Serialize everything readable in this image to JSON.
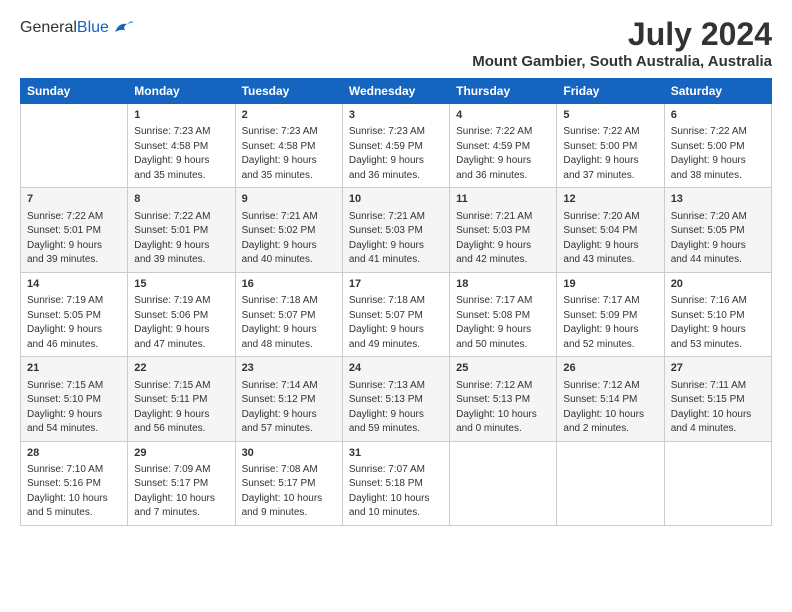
{
  "header": {
    "logo_general": "General",
    "logo_blue": "Blue",
    "title": "July 2024",
    "subtitle": "Mount Gambier, South Australia, Australia"
  },
  "days_of_week": [
    "Sunday",
    "Monday",
    "Tuesday",
    "Wednesday",
    "Thursday",
    "Friday",
    "Saturday"
  ],
  "weeks": [
    [
      {
        "day": "",
        "info": ""
      },
      {
        "day": "1",
        "info": "Sunrise: 7:23 AM\nSunset: 4:58 PM\nDaylight: 9 hours\nand 35 minutes."
      },
      {
        "day": "2",
        "info": "Sunrise: 7:23 AM\nSunset: 4:58 PM\nDaylight: 9 hours\nand 35 minutes."
      },
      {
        "day": "3",
        "info": "Sunrise: 7:23 AM\nSunset: 4:59 PM\nDaylight: 9 hours\nand 36 minutes."
      },
      {
        "day": "4",
        "info": "Sunrise: 7:22 AM\nSunset: 4:59 PM\nDaylight: 9 hours\nand 36 minutes."
      },
      {
        "day": "5",
        "info": "Sunrise: 7:22 AM\nSunset: 5:00 PM\nDaylight: 9 hours\nand 37 minutes."
      },
      {
        "day": "6",
        "info": "Sunrise: 7:22 AM\nSunset: 5:00 PM\nDaylight: 9 hours\nand 38 minutes."
      }
    ],
    [
      {
        "day": "7",
        "info": "Sunrise: 7:22 AM\nSunset: 5:01 PM\nDaylight: 9 hours\nand 39 minutes."
      },
      {
        "day": "8",
        "info": "Sunrise: 7:22 AM\nSunset: 5:01 PM\nDaylight: 9 hours\nand 39 minutes."
      },
      {
        "day": "9",
        "info": "Sunrise: 7:21 AM\nSunset: 5:02 PM\nDaylight: 9 hours\nand 40 minutes."
      },
      {
        "day": "10",
        "info": "Sunrise: 7:21 AM\nSunset: 5:03 PM\nDaylight: 9 hours\nand 41 minutes."
      },
      {
        "day": "11",
        "info": "Sunrise: 7:21 AM\nSunset: 5:03 PM\nDaylight: 9 hours\nand 42 minutes."
      },
      {
        "day": "12",
        "info": "Sunrise: 7:20 AM\nSunset: 5:04 PM\nDaylight: 9 hours\nand 43 minutes."
      },
      {
        "day": "13",
        "info": "Sunrise: 7:20 AM\nSunset: 5:05 PM\nDaylight: 9 hours\nand 44 minutes."
      }
    ],
    [
      {
        "day": "14",
        "info": "Sunrise: 7:19 AM\nSunset: 5:05 PM\nDaylight: 9 hours\nand 46 minutes."
      },
      {
        "day": "15",
        "info": "Sunrise: 7:19 AM\nSunset: 5:06 PM\nDaylight: 9 hours\nand 47 minutes."
      },
      {
        "day": "16",
        "info": "Sunrise: 7:18 AM\nSunset: 5:07 PM\nDaylight: 9 hours\nand 48 minutes."
      },
      {
        "day": "17",
        "info": "Sunrise: 7:18 AM\nSunset: 5:07 PM\nDaylight: 9 hours\nand 49 minutes."
      },
      {
        "day": "18",
        "info": "Sunrise: 7:17 AM\nSunset: 5:08 PM\nDaylight: 9 hours\nand 50 minutes."
      },
      {
        "day": "19",
        "info": "Sunrise: 7:17 AM\nSunset: 5:09 PM\nDaylight: 9 hours\nand 52 minutes."
      },
      {
        "day": "20",
        "info": "Sunrise: 7:16 AM\nSunset: 5:10 PM\nDaylight: 9 hours\nand 53 minutes."
      }
    ],
    [
      {
        "day": "21",
        "info": "Sunrise: 7:15 AM\nSunset: 5:10 PM\nDaylight: 9 hours\nand 54 minutes."
      },
      {
        "day": "22",
        "info": "Sunrise: 7:15 AM\nSunset: 5:11 PM\nDaylight: 9 hours\nand 56 minutes."
      },
      {
        "day": "23",
        "info": "Sunrise: 7:14 AM\nSunset: 5:12 PM\nDaylight: 9 hours\nand 57 minutes."
      },
      {
        "day": "24",
        "info": "Sunrise: 7:13 AM\nSunset: 5:13 PM\nDaylight: 9 hours\nand 59 minutes."
      },
      {
        "day": "25",
        "info": "Sunrise: 7:12 AM\nSunset: 5:13 PM\nDaylight: 10 hours\nand 0 minutes."
      },
      {
        "day": "26",
        "info": "Sunrise: 7:12 AM\nSunset: 5:14 PM\nDaylight: 10 hours\nand 2 minutes."
      },
      {
        "day": "27",
        "info": "Sunrise: 7:11 AM\nSunset: 5:15 PM\nDaylight: 10 hours\nand 4 minutes."
      }
    ],
    [
      {
        "day": "28",
        "info": "Sunrise: 7:10 AM\nSunset: 5:16 PM\nDaylight: 10 hours\nand 5 minutes."
      },
      {
        "day": "29",
        "info": "Sunrise: 7:09 AM\nSunset: 5:17 PM\nDaylight: 10 hours\nand 7 minutes."
      },
      {
        "day": "30",
        "info": "Sunrise: 7:08 AM\nSunset: 5:17 PM\nDaylight: 10 hours\nand 9 minutes."
      },
      {
        "day": "31",
        "info": "Sunrise: 7:07 AM\nSunset: 5:18 PM\nDaylight: 10 hours\nand 10 minutes."
      },
      {
        "day": "",
        "info": ""
      },
      {
        "day": "",
        "info": ""
      },
      {
        "day": "",
        "info": ""
      }
    ]
  ]
}
